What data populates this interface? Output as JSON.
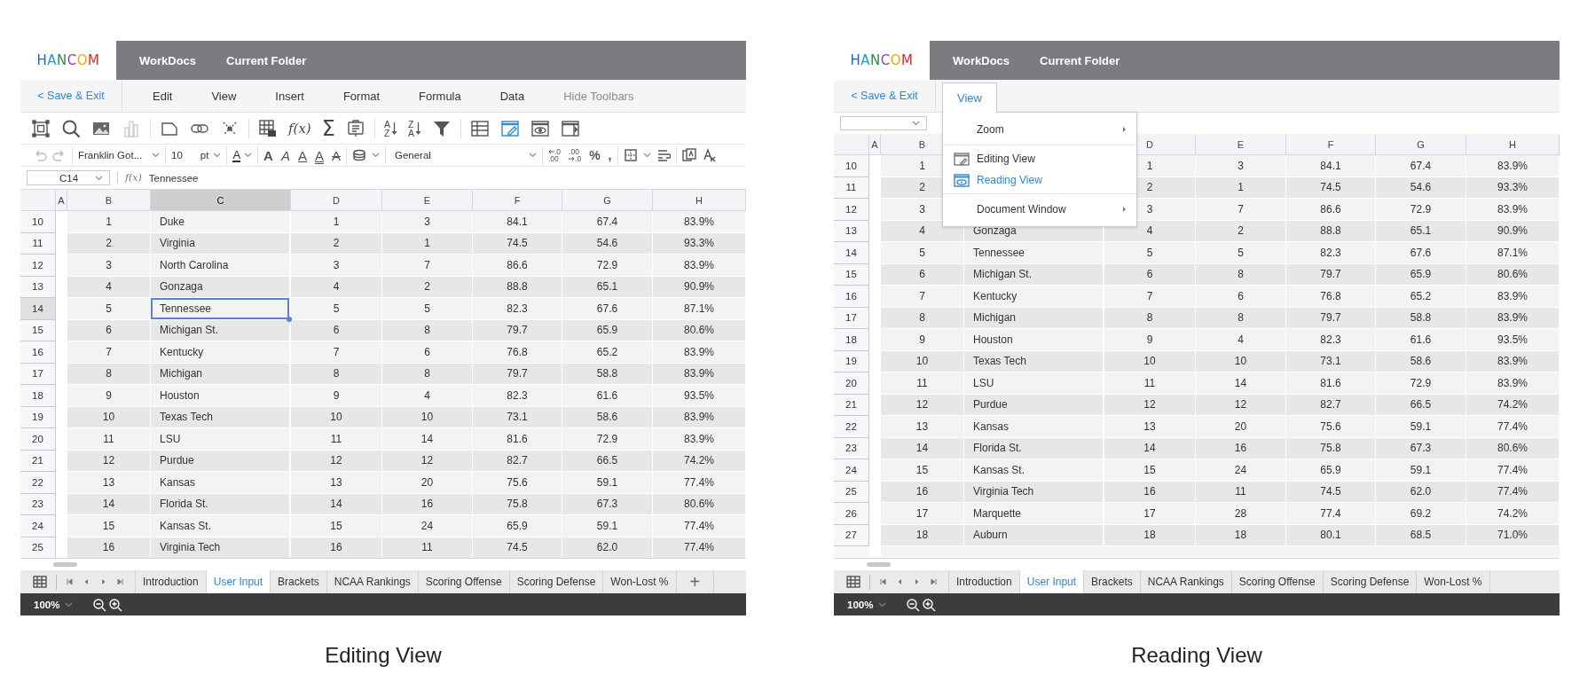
{
  "panels": [
    {
      "kind": "editing",
      "caption": "Editing View",
      "logo": "HANCOM",
      "nav": [
        "WorkDocs",
        "Current Folder"
      ],
      "save_exit": "< Save & Exit",
      "menu": [
        {
          "label": "Edit",
          "selected": false,
          "dimmed": false
        },
        {
          "label": "View",
          "selected": false,
          "dimmed": false
        },
        {
          "label": "Insert",
          "selected": false,
          "dimmed": false
        },
        {
          "label": "Format",
          "selected": false,
          "dimmed": false
        },
        {
          "label": "Formula",
          "selected": false,
          "dimmed": false
        },
        {
          "label": "Data",
          "selected": false,
          "dimmed": false
        },
        {
          "label": "Hide Toolbars",
          "selected": false,
          "dimmed": true
        }
      ],
      "icon_toolbar": [
        [
          {
            "kind": "frame"
          },
          {
            "kind": "search"
          },
          {
            "kind": "image"
          },
          {
            "kind": "chart"
          }
        ],
        [
          {
            "kind": "page"
          },
          {
            "kind": "link"
          },
          {
            "kind": "cross"
          }
        ],
        [
          {
            "kind": "table_insert"
          },
          {
            "kind": "function",
            "text": "f(x)"
          },
          {
            "kind": "sum",
            "text": "Σ"
          },
          {
            "kind": "memo"
          }
        ],
        [
          {
            "kind": "sort_asc",
            "top": "A",
            "bottom": "Z"
          },
          {
            "kind": "sort_desc",
            "top": "Z",
            "bottom": "A"
          },
          {
            "kind": "filter"
          }
        ],
        [
          {
            "kind": "grid"
          },
          {
            "kind": "edit_view"
          },
          {
            "kind": "read_view"
          },
          {
            "kind": "panel"
          }
        ]
      ],
      "format_toolbar": {
        "font": "Franklin Got...",
        "size": "10",
        "unit": "pt",
        "font_color": "A",
        "styles": [
          {
            "kind": "bold",
            "text": "A"
          },
          {
            "kind": "italic",
            "text": "A"
          },
          {
            "kind": "underline",
            "text": "A"
          },
          {
            "kind": "double",
            "text": "A"
          },
          {
            "kind": "strike",
            "text": "A"
          }
        ],
        "number_format": "General",
        "decimals": [
          {
            "kind": "increase",
            "top": ".0",
            "bottom": ".00"
          },
          {
            "kind": "decrease",
            "top": ".00",
            "bottom": ".0"
          }
        ],
        "symbols": [
          "%",
          ","
        ]
      },
      "formula_bar": {
        "cell": "C14",
        "fx": "f(x)",
        "value": "Tennessee"
      },
      "columns": [
        {
          "label": "A",
          "selected": false
        },
        {
          "label": "B",
          "selected": false
        },
        {
          "label": "C",
          "selected": true
        },
        {
          "label": "D",
          "selected": false
        },
        {
          "label": "E",
          "selected": false
        },
        {
          "label": "F",
          "selected": false
        },
        {
          "label": "G",
          "selected": false
        },
        {
          "label": "H",
          "selected": false
        }
      ],
      "rows": [
        {
          "row": "10",
          "selected": false,
          "B": "1",
          "C": "Duke",
          "D": "1",
          "E": "3",
          "F": "84.1",
          "G": "67.4",
          "H": "83.9%"
        },
        {
          "row": "11",
          "selected": false,
          "B": "2",
          "C": "Virginia",
          "D": "2",
          "E": "1",
          "F": "74.5",
          "G": "54.6",
          "H": "93.3%"
        },
        {
          "row": "12",
          "selected": false,
          "B": "3",
          "C": "North Carolina",
          "D": "3",
          "E": "7",
          "F": "86.6",
          "G": "72.9",
          "H": "83.9%"
        },
        {
          "row": "13",
          "selected": false,
          "B": "4",
          "C": "Gonzaga",
          "D": "4",
          "E": "2",
          "F": "88.8",
          "G": "65.1",
          "H": "90.9%"
        },
        {
          "row": "14",
          "selected": true,
          "B": "5",
          "C": "Tennessee",
          "D": "5",
          "E": "5",
          "F": "82.3",
          "G": "67.6",
          "H": "87.1%"
        },
        {
          "row": "15",
          "selected": false,
          "B": "6",
          "C": "Michigan St.",
          "D": "6",
          "E": "8",
          "F": "79.7",
          "G": "65.9",
          "H": "80.6%"
        },
        {
          "row": "16",
          "selected": false,
          "B": "7",
          "C": "Kentucky",
          "D": "7",
          "E": "6",
          "F": "76.8",
          "G": "65.2",
          "H": "83.9%"
        },
        {
          "row": "17",
          "selected": false,
          "B": "8",
          "C": "Michigan",
          "D": "8",
          "E": "8",
          "F": "79.7",
          "G": "58.8",
          "H": "83.9%"
        },
        {
          "row": "18",
          "selected": false,
          "B": "9",
          "C": "Houston",
          "D": "9",
          "E": "4",
          "F": "82.3",
          "G": "61.6",
          "H": "93.5%"
        },
        {
          "row": "19",
          "selected": false,
          "B": "10",
          "C": "Texas Tech",
          "D": "10",
          "E": "10",
          "F": "73.1",
          "G": "58.6",
          "H": "83.9%"
        },
        {
          "row": "20",
          "selected": false,
          "B": "11",
          "C": "LSU",
          "D": "11",
          "E": "14",
          "F": "81.6",
          "G": "72.9",
          "H": "83.9%"
        },
        {
          "row": "21",
          "selected": false,
          "B": "12",
          "C": "Purdue",
          "D": "12",
          "E": "12",
          "F": "82.7",
          "G": "66.5",
          "H": "74.2%"
        },
        {
          "row": "22",
          "selected": false,
          "B": "13",
          "C": "Kansas",
          "D": "13",
          "E": "20",
          "F": "75.6",
          "G": "59.1",
          "H": "77.4%"
        },
        {
          "row": "23",
          "selected": false,
          "B": "14",
          "C": "Florida St.",
          "D": "14",
          "E": "16",
          "F": "75.8",
          "G": "67.3",
          "H": "80.6%"
        },
        {
          "row": "24",
          "selected": false,
          "B": "15",
          "C": "Kansas St.",
          "D": "15",
          "E": "24",
          "F": "65.9",
          "G": "59.1",
          "H": "77.4%"
        },
        {
          "row": "25",
          "selected": false,
          "B": "16",
          "C": "Virginia Tech",
          "D": "16",
          "E": "11",
          "F": "74.5",
          "G": "62.0",
          "H": "77.4%"
        }
      ],
      "sheet_tabs": [
        {
          "label": "Introduction",
          "selected": false
        },
        {
          "label": "User Input",
          "selected": true
        },
        {
          "label": "Brackets",
          "selected": false
        },
        {
          "label": "NCAA Rankings",
          "selected": false
        },
        {
          "label": "Scoring Offense",
          "selected": false
        },
        {
          "label": "Scoring Defense",
          "selected": false
        },
        {
          "label": "Won-Lost %",
          "selected": false
        }
      ],
      "add_tab": "+",
      "zoom": "100%"
    },
    {
      "kind": "reading",
      "caption": "Reading View",
      "logo": "HANCOM",
      "nav": [
        "WorkDocs",
        "Current Folder"
      ],
      "save_exit": "< Save & Exit",
      "menu": [
        {
          "label": "View",
          "selected": true,
          "dimmed": false
        }
      ],
      "dropdown": [
        [
          {
            "kind": "submenu",
            "label": "Zoom"
          }
        ],
        [
          {
            "kind": "edit_view",
            "label": "Editing View",
            "selected": false
          },
          {
            "kind": "read_view",
            "label": "Reading View",
            "selected": true
          }
        ],
        [
          {
            "kind": "submenu",
            "label": "Document Window"
          }
        ]
      ],
      "columns": [
        {
          "label": "A",
          "selected": false
        },
        {
          "label": "B",
          "selected": false
        },
        null,
        {
          "label": "D",
          "selected": false
        },
        {
          "label": "E",
          "selected": false
        },
        {
          "label": "F",
          "selected": false
        },
        {
          "label": "G",
          "selected": false
        },
        {
          "label": "H",
          "selected": false
        }
      ],
      "rows": [
        {
          "row": "10",
          "selected": false,
          "B": "1",
          "D": "1",
          "E": "3",
          "F": "84.1",
          "G": "67.4",
          "H": "83.9%"
        },
        {
          "row": "11",
          "selected": false,
          "B": "2",
          "D": "2",
          "E": "1",
          "F": "74.5",
          "G": "54.6",
          "H": "93.3%"
        },
        {
          "row": "12",
          "selected": false,
          "B": "3",
          "D": "3",
          "E": "7",
          "F": "86.6",
          "G": "72.9",
          "H": "83.9%"
        },
        {
          "row": "13",
          "selected": false,
          "B": "4",
          "C": "Gonzaga",
          "D": "4",
          "E": "2",
          "F": "88.8",
          "G": "65.1",
          "H": "90.9%"
        },
        {
          "row": "14",
          "selected": false,
          "B": "5",
          "C": "Tennessee",
          "D": "5",
          "E": "5",
          "F": "82.3",
          "G": "67.6",
          "H": "87.1%"
        },
        {
          "row": "15",
          "selected": false,
          "B": "6",
          "C": "Michigan St.",
          "D": "6",
          "E": "8",
          "F": "79.7",
          "G": "65.9",
          "H": "80.6%"
        },
        {
          "row": "16",
          "selected": false,
          "B": "7",
          "C": "Kentucky",
          "D": "7",
          "E": "6",
          "F": "76.8",
          "G": "65.2",
          "H": "83.9%"
        },
        {
          "row": "17",
          "selected": false,
          "B": "8",
          "C": "Michigan",
          "D": "8",
          "E": "8",
          "F": "79.7",
          "G": "58.8",
          "H": "83.9%"
        },
        {
          "row": "18",
          "selected": false,
          "B": "9",
          "C": "Houston",
          "D": "9",
          "E": "4",
          "F": "82.3",
          "G": "61.6",
          "H": "93.5%"
        },
        {
          "row": "19",
          "selected": false,
          "B": "10",
          "C": "Texas Tech",
          "D": "10",
          "E": "10",
          "F": "73.1",
          "G": "58.6",
          "H": "83.9%"
        },
        {
          "row": "20",
          "selected": false,
          "B": "11",
          "C": "LSU",
          "D": "11",
          "E": "14",
          "F": "81.6",
          "G": "72.9",
          "H": "83.9%"
        },
        {
          "row": "21",
          "selected": false,
          "B": "12",
          "C": "Purdue",
          "D": "12",
          "E": "12",
          "F": "82.7",
          "G": "66.5",
          "H": "74.2%"
        },
        {
          "row": "22",
          "selected": false,
          "B": "13",
          "C": "Kansas",
          "D": "13",
          "E": "20",
          "F": "75.6",
          "G": "59.1",
          "H": "77.4%"
        },
        {
          "row": "23",
          "selected": false,
          "B": "14",
          "C": "Florida St.",
          "D": "14",
          "E": "16",
          "F": "75.8",
          "G": "67.3",
          "H": "80.6%"
        },
        {
          "row": "24",
          "selected": false,
          "B": "15",
          "C": "Kansas St.",
          "D": "15",
          "E": "24",
          "F": "65.9",
          "G": "59.1",
          "H": "77.4%"
        },
        {
          "row": "25",
          "selected": false,
          "B": "16",
          "C": "Virginia Tech",
          "D": "16",
          "E": "11",
          "F": "74.5",
          "G": "62.0",
          "H": "77.4%"
        },
        {
          "row": "26",
          "selected": false,
          "B": "17",
          "C": "Marquette",
          "D": "17",
          "E": "28",
          "F": "77.4",
          "G": "69.2",
          "H": "74.2%"
        },
        {
          "row": "27",
          "selected": false,
          "B": "18",
          "C": "Auburn",
          "D": "18",
          "E": "18",
          "F": "80.1",
          "G": "68.5",
          "H": "71.0%"
        }
      ],
      "sheet_tabs": [
        {
          "label": "Introduction",
          "selected": false
        },
        {
          "label": "User Input",
          "selected": true
        },
        {
          "label": "Brackets",
          "selected": false
        },
        {
          "label": "NCAA Rankings",
          "selected": false
        },
        {
          "label": "Scoring Offense",
          "selected": false
        },
        {
          "label": "Scoring Defense",
          "selected": false
        },
        {
          "label": "Won-Lost %",
          "selected": false
        }
      ],
      "zoom": "100%"
    }
  ]
}
